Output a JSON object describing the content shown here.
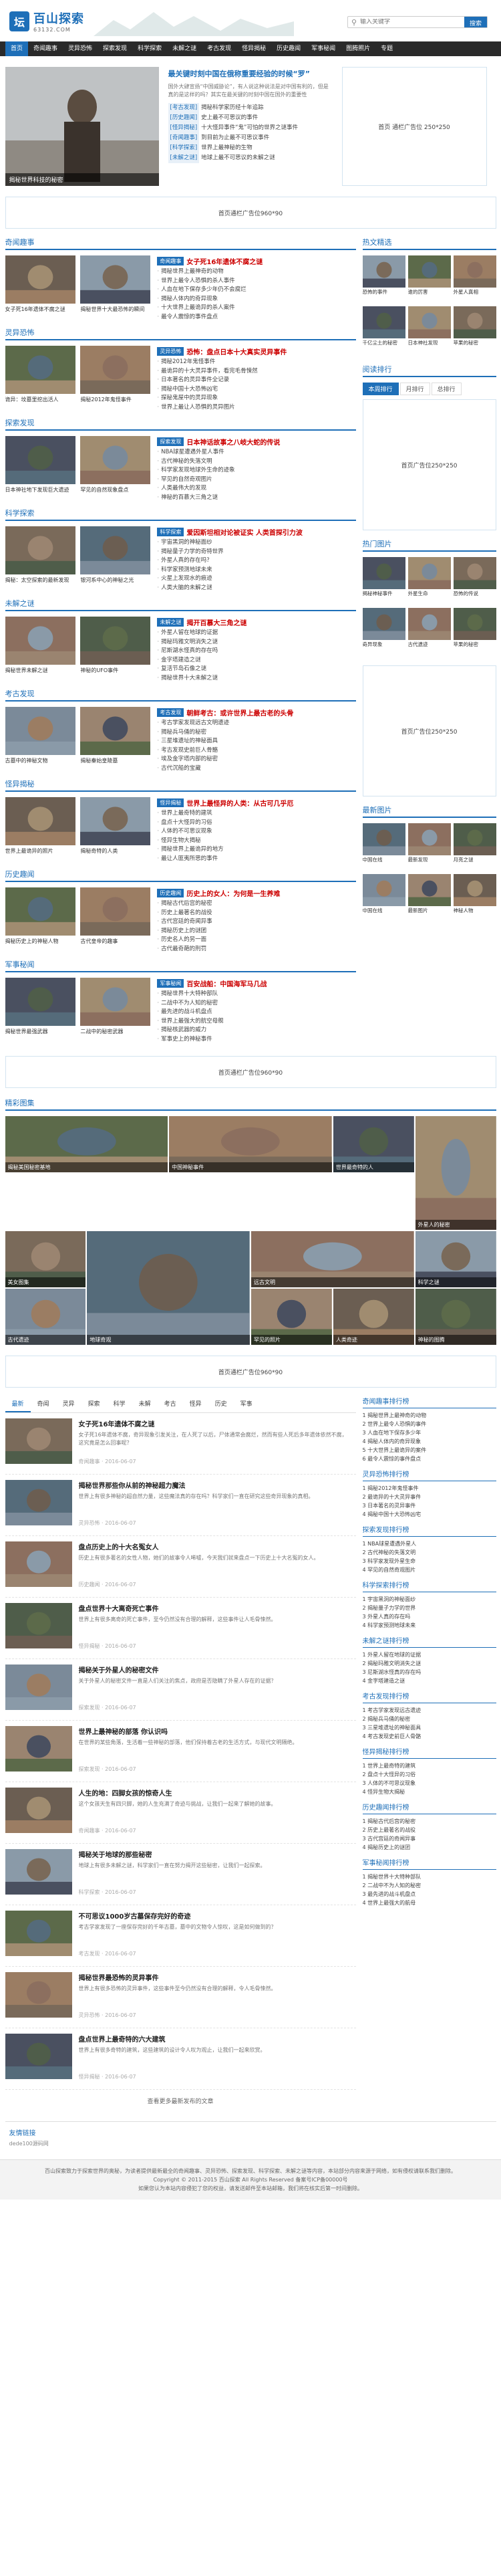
{
  "header": {
    "logo_mark": "坛",
    "logo_title": "百山探索",
    "logo_sub": "63132.COM",
    "search_placeholder": "输入关键字",
    "search_button": "搜索"
  },
  "nav": [
    "首页",
    "奇闻趣事",
    "灵异恐怖",
    "探索发现",
    "科学探索",
    "未解之谜",
    "考古发现",
    "怪异揭秘",
    "历史趣闻",
    "军事秘闻",
    "图腾照片",
    "专题"
  ],
  "feature": {
    "image_caption": "揭秘世界科技的秘密",
    "title": "最关键时刻中国在俄称重要经验的时候“罗”",
    "desc": "国外大肆宣扬“中国威胁论”，有人说这种说法是对中国有利的，但是真的是这样的吗？其实在最关键的时刻中国在国外的重要性",
    "lines": [
      {
        "tag": "[考古发现]",
        "text": "揭秘科学家历经十年追踪"
      },
      {
        "tag": "[历史趣闻]",
        "text": "史上最不可思议的事件"
      },
      {
        "tag": "[怪异揭秘]",
        "text": "十大怪异事件“鬼”可怕的世界之谜事件"
      },
      {
        "tag": "[奇闻趣事]",
        "text": "到目前为止最不可思议事件"
      },
      {
        "tag": "[科学探索]",
        "text": "世界上最神秘的生物"
      },
      {
        "tag": "[未解之谜]",
        "text": "地球上最不可思议的未解之谜"
      }
    ]
  },
  "ads": {
    "top_right": "首页 通栏广告位 250*250",
    "full_1": "首页通栏广告位960*90",
    "side_2": "首页广告位250*250",
    "side_3": "首页广告位250*250",
    "full_2": "首页通栏广告位960*90",
    "full_3": "首页通栏广告位960*90"
  },
  "sections": [
    {
      "name": "奇闻趣事",
      "thumbs": [
        "女子死16年遗体不腐之谜",
        "揭秘世界十大最恐怖的瞬间"
      ],
      "badge": "奇闻趣事",
      "headline": "女子死16年遗体不腐之谜",
      "lines": [
        "揭秘世界上最神奇的动物",
        "世界上最令人恐惧的杀人事件",
        "人血在地下保存多少年仍不会腐烂",
        "揭秘人体内的奇异现象",
        "十大世界上最诡异的杀人案件",
        "最令人震惊的事件盘点"
      ]
    },
    {
      "name": "灵异恐怖",
      "thumbs": [
        "诡异：坟墓里挖出活人",
        "揭秘2012年鬼怪事件"
      ],
      "badge": "灵异恐怖",
      "headline": "恐怖：盘点日本十大真实灵异事件",
      "lines": [
        "揭秘2012年鬼怪事件",
        "最诡异的十大灵异事件，看完毛骨悚然",
        "日本著名的灵异事件全记录",
        "揭秘中国十大恐怖凶宅",
        "探秘鬼屋中的灵异现象",
        "世界上最让人恐惧的灵异图片"
      ]
    },
    {
      "name": "探索发现",
      "thumbs": [
        "日本神社地下发现巨大遗迹",
        "罕见的自然现象盘点"
      ],
      "badge": "探索发现",
      "headline": "日本神话故事之八岐大蛇的传说",
      "lines": [
        "NBA球星遭遇外星人事件",
        "古代神秘的失落文明",
        "科学家发现地球外生命的迹象",
        "罕见的自然奇观图片",
        "人类最伟大的发现",
        "神秘的百慕大三角之谜"
      ]
    },
    {
      "name": "科学探索",
      "thumbs": [
        "揭秘：太空探索的最新发现",
        "银河系中心的神秘之光"
      ],
      "badge": "科学探索",
      "headline": "爱因斯坦相对论被证实 人类首探引力波",
      "lines": [
        "宇宙黑洞的神秘面纱",
        "揭秘量子力学的奇特世界",
        "外星人真的存在吗？",
        "科学家预测地球未来",
        "火星上发现水的痕迹",
        "人类大脑的未解之谜"
      ]
    },
    {
      "name": "未解之谜",
      "thumbs": [
        "揭秘世界未解之谜",
        "神秘的UFO事件"
      ],
      "badge": "未解之谜",
      "headline": "揭开百慕大三角之谜",
      "lines": [
        "外星人留在地球的证据",
        "揭秘玛雅文明消失之谜",
        "尼斯湖水怪真的存在吗",
        "金字塔建造之谜",
        "复活节岛石像之谜",
        "揭秘世界十大未解之谜"
      ]
    },
    {
      "name": "考古发现",
      "thumbs": [
        "古墓中的神秘文物",
        "揭秘秦始皇陵墓"
      ],
      "badge": "考古发现",
      "headline": "朝鲜考古：或许世界上最古老的头骨",
      "lines": [
        "考古学家发现远古文明遗迹",
        "揭秘兵马俑的秘密",
        "三星堆遗址的神秘面具",
        "考古发现史前巨人骨骼",
        "埃及金字塔内部的秘密",
        "古代沉船的宝藏"
      ]
    },
    {
      "name": "怪异揭秘",
      "thumbs": [
        "世界上最诡异的照片",
        "揭秘奇特的人类"
      ],
      "badge": "怪异揭秘",
      "headline": "世界上最怪异的人类：从古可几乎厄",
      "lines": [
        "世界上最奇特的建筑",
        "盘点十大怪异的习俗",
        "人体的不可思议现象",
        "怪异生物大揭秘",
        "揭秘世界上最诡异的地方",
        "最让人匪夷所思的事件"
      ]
    },
    {
      "name": "历史趣闻",
      "thumbs": [
        "揭秘历史上的神秘人物",
        "古代皇帝的趣事"
      ],
      "badge": "历史趣闻",
      "headline": "历史上的女人：为何是一生养难",
      "lines": [
        "揭秘古代后宫的秘密",
        "历史上最著名的战役",
        "古代宫廷的奇闻异事",
        "揭秘历史上的谜团",
        "历史名人的另一面",
        "古代最奇葩的刑罚"
      ]
    },
    {
      "name": "军事秘闻",
      "thumbs": [
        "揭秘世界最强武器",
        "二战中的秘密武器"
      ],
      "badge": "军事秘闻",
      "headline": "百安战船：中国海军马几战",
      "lines": [
        "揭秘世界十大特种部队",
        "二战中不为人知的秘密",
        "最先进的战斗机盘点",
        "世界上最强大的航空母舰",
        "揭秘核武器的威力",
        "军事史上的神秘事件"
      ]
    }
  ],
  "side": {
    "hot_title": "热文精选",
    "hot": [
      "恐怖的事件",
      "谁的厉害",
      "外星人真相",
      "千亿尘土的秘密",
      "日本神社发现",
      "苹果的秘密"
    ],
    "read_title": "阅读排行",
    "tabs": [
      "本周排行",
      "月排行",
      "总排行"
    ],
    "pic_title": "热门图片",
    "pics": [
      "揭秘神秘事件",
      "外星生命",
      "恐怖的传说",
      "奇异现象",
      "古代遗迹",
      "苹果的秘密"
    ],
    "rec_title": "最新图片",
    "recs": [
      "中国在线",
      "最新发现",
      "月亮之谜",
      "中国在线",
      "最新图片",
      "神秘人物"
    ]
  },
  "photo": {
    "title": "精彩图集",
    "items": [
      "揭秘美国秘密基地",
      "中国神秘事件",
      "世界最奇特的人",
      "外星人的秘密",
      "美女图集",
      "地球奇观",
      "远古文明",
      "神秘的图腾",
      "古代遗迹",
      "罕见的照片",
      "人类奇迹",
      "科学之谜"
    ]
  },
  "bottom": {
    "tabs": [
      "最新",
      "奇闻",
      "灵异",
      "探索",
      "科学",
      "未解",
      "考古",
      "怪异",
      "历史",
      "军事"
    ],
    "articles": [
      {
        "title": "女子死16年遗体不腐之谜",
        "desc": "女子死16年遗体不腐，奇异现象引发关注，在人死了以后，尸体通常会腐烂，然而有些人死后多年遗体依然不腐，这究竟是怎么回事呢？",
        "meta": "奇闻趣事 · 2016-06-07"
      },
      {
        "title": "揭秘世界那些你从前的神秘超力魔法",
        "desc": "世界上有很多神秘的超自然力量，这些魔法真的存在吗？科学家们一直在研究这些奇异现象的真相。",
        "meta": "灵异恐怖 · 2016-06-07"
      },
      {
        "title": "盘点历史上的十大名冤女人",
        "desc": "历史上有很多著名的女性人物，她们的故事令人唏嘘，今天我们就来盘点一下历史上十大名冤的女人。",
        "meta": "历史趣闻 · 2016-06-07"
      },
      {
        "title": "盘点世界十大离奇死亡事件",
        "desc": "世界上有很多离奇的死亡事件，至今仍然没有合理的解释，这些事件让人毛骨悚然。",
        "meta": "怪异揭秘 · 2016-06-07"
      },
      {
        "title": "揭秘关于外星人的秘密文件",
        "desc": "关于外星人的秘密文件一直是人们关注的焦点，政府是否隐瞒了外星人存在的证据？",
        "meta": "探索发现 · 2016-06-07"
      },
      {
        "title": "世界上最神秘的部落 你认识吗",
        "desc": "在世界的某些角落，生活着一些神秘的部落，他们保持着古老的生活方式，与现代文明隔绝。",
        "meta": "探索发现 · 2016-06-07"
      },
      {
        "title": "人生的地：四脚女孩的惊奇人生",
        "desc": "这个女孩天生有四只脚，她的人生充满了奇迹与挑战，让我们一起来了解她的故事。",
        "meta": "奇闻趣事 · 2016-06-07"
      },
      {
        "title": "揭秘关于地球的那些秘密",
        "desc": "地球上有很多未解之谜，科学家们一直在努力揭开这些秘密，让我们一起探索。",
        "meta": "科学探索 · 2016-06-07"
      },
      {
        "title": "不可思议1000岁古墓保存完好的奇迹",
        "desc": "考古学家发现了一座保存完好的千年古墓，墓中的文物令人惊叹，这是如何做到的？",
        "meta": "考古发现 · 2016-06-07"
      },
      {
        "title": "揭秘世界最恐怖的灵异事件",
        "desc": "世界上有很多恐怖的灵异事件，这些事件至今仍然没有合理的解释，令人毛骨悚然。",
        "meta": "灵异恐怖 · 2016-06-07"
      },
      {
        "title": "盘点世界上最奇特的六大建筑",
        "desc": "世界上有很多奇特的建筑，这些建筑的设计令人叹为观止，让我们一起来欣赏。",
        "meta": "怪异揭秘 · 2016-06-07"
      }
    ],
    "more": "查看更多最新发布的文章"
  },
  "ranks": [
    {
      "title": "奇闻趣事排行榜",
      "lines": [
        "1 揭秘世界上最神奇的动物",
        "2 世界上最令人恐惧的事件",
        "3 人血在地下保存多少年",
        "4 揭秘人体内的奇异现象",
        "5 十大世界上最诡异的案件",
        "6 最令人震惊的事件盘点"
      ]
    },
    {
      "title": "灵异恐怖排行榜",
      "lines": [
        "1 揭秘2012年鬼怪事件",
        "2 最诡异的十大灵异事件",
        "3 日本著名的灵异事件",
        "4 揭秘中国十大恐怖凶宅"
      ]
    },
    {
      "title": "探索发现排行榜",
      "lines": [
        "1 NBA球星遭遇外星人",
        "2 古代神秘的失落文明",
        "3 科学家发现外星生命",
        "4 罕见的自然奇观图片"
      ]
    },
    {
      "title": "科学探索排行榜",
      "lines": [
        "1 宇宙黑洞的神秘面纱",
        "2 揭秘量子力学的世界",
        "3 外星人真的存在吗",
        "4 科学家预测地球未来"
      ]
    },
    {
      "title": "未解之谜排行榜",
      "lines": [
        "1 外星人留在地球的证据",
        "2 揭秘玛雅文明消失之谜",
        "3 尼斯湖水怪真的存在吗",
        "4 金字塔建造之谜"
      ]
    },
    {
      "title": "考古发现排行榜",
      "lines": [
        "1 考古学家发现远古遗迹",
        "2 揭秘兵马俑的秘密",
        "3 三星堆遗址的神秘面具",
        "4 考古发现史前巨人骨骼"
      ]
    },
    {
      "title": "怪异揭秘排行榜",
      "lines": [
        "1 世界上最奇特的建筑",
        "2 盘点十大怪异的习俗",
        "3 人体的不可思议现象",
        "4 怪异生物大揭秘"
      ]
    },
    {
      "title": "历史趣闻排行榜",
      "lines": [
        "1 揭秘古代后宫的秘密",
        "2 历史上最著名的战役",
        "3 古代宫廷的奇闻异事",
        "4 揭秘历史上的谜团"
      ]
    },
    {
      "title": "军事秘闻排行榜",
      "lines": [
        "1 揭秘世界十大特种部队",
        "2 二战中不为人知的秘密",
        "3 最先进的战斗机盘点",
        "4 世界上最强大的航母"
      ]
    }
  ],
  "friend": {
    "title": "友情链接",
    "item": "dede100源码网"
  },
  "footer": {
    "line1": "百山探索致力于探索世界的奥秘，为读者提供最新最全的奇闻趣事、灵异恐怖、探索发现、科学探索、未解之谜等内容，本站部分内容来源于网络，如有侵权请联系我们删除。",
    "line2": "Copyright © 2011-2015 百山探索 All Rights Reserved 备案号ICP备00000号",
    "line3": "如果您认为本站内容侵犯了您的权益，请发送邮件至本站邮箱，我们将在核实后第一时间删除。"
  },
  "colors": {
    "accent": "#1e6fb8",
    "nav_bg": "#2a2a2a",
    "hot": "#cc0000"
  }
}
